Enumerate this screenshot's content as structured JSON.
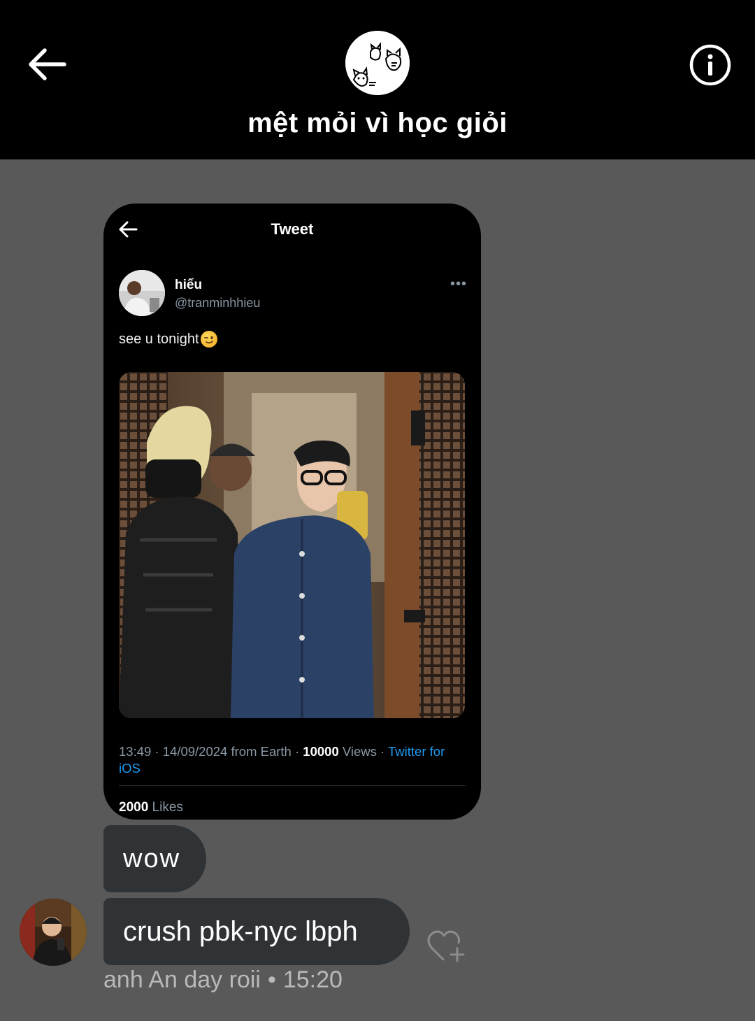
{
  "header": {
    "title": "mệt mỏi vì học giỏi",
    "back_icon": "arrow-left-icon",
    "info_icon": "info-circle-icon",
    "avatar": "group-avatar-cats-drawing"
  },
  "shared_tweet": {
    "header_title": "Tweet",
    "author_name": "hiếu",
    "author_handle": "@tranminhhieu",
    "more_icon": "more-dots-icon",
    "text": "see u tonight",
    "emoji": "winking-face-emoji",
    "photo": "mirror-selfie-two-people-elevator",
    "time": "13:49",
    "sep1": " · ",
    "date": "14/09/2024",
    "location": " from Earth",
    "sep2": " · ",
    "views_count": "10000",
    "views_label": " Views",
    "sep3": " · ",
    "client": "Twitter for iOS",
    "likes_count": "2000",
    "likes_label": " Likes"
  },
  "messages": [
    {
      "text": "wow"
    },
    {
      "text": "crush pbk-nyc lbph"
    }
  ],
  "message_meta": {
    "sender": "anh An day roii",
    "separator": "•",
    "time": "15:20"
  },
  "reaction": {
    "icon": "heart-plus-icon"
  },
  "colors": {
    "background": "#595959",
    "bubble": "#2f3336",
    "link": "#1d9bf0",
    "muted": "#8b98a5"
  }
}
